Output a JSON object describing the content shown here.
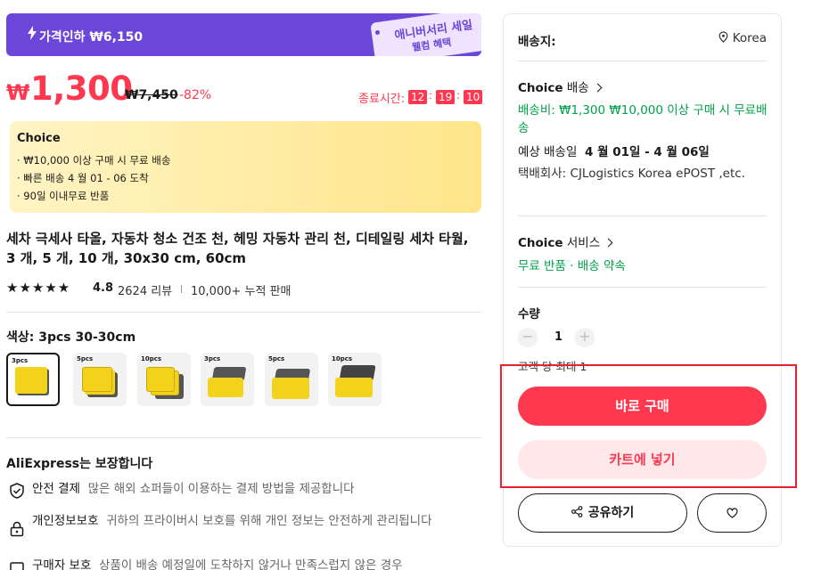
{
  "promo": {
    "text": "가격인하 ₩6,150",
    "tag_line1": "애니버서리 세일",
    "tag_line2": "웰컴 혜택"
  },
  "price": {
    "currency": "₩",
    "current": "1,300",
    "original": "₩7,450",
    "discount": "-82%"
  },
  "timer": {
    "label": "종료시간:",
    "hours": "12",
    "minutes": "19",
    "seconds": "10",
    "sep": ":"
  },
  "choice": {
    "title": "Choice",
    "lines": [
      "· ₩10,000 이상 구매 시 무료 배송",
      "· 빠른 배송 4 월 01 - 06 도착",
      "· 90일 이내무료 반품"
    ]
  },
  "product": {
    "title": "세차 극세사 타올, 자동차 청소 건조 천, 헤밍 자동차 관리 천, 디테일링 세차 타월, 3 개, 5 개, 10 개, 30x30 cm, 60cm",
    "stars": "★★★★★",
    "rating": "4.8",
    "reviews": "2624 리뷰",
    "sold": "10,000+ 누적 판매"
  },
  "color": {
    "label": "색상: 3pcs 30-30cm",
    "swatches": [
      {
        "pcs": "3pcs",
        "selected": true
      },
      {
        "pcs": "5pcs",
        "selected": false
      },
      {
        "pcs": "10pcs",
        "selected": false
      },
      {
        "pcs": "3pcs",
        "selected": false
      },
      {
        "pcs": "5pcs",
        "selected": false
      },
      {
        "pcs": "10pcs",
        "selected": false
      }
    ]
  },
  "guarantee": {
    "title": "AliExpress는 보장합니다",
    "items": [
      {
        "icon": "shield-check-icon",
        "title": "안전 결제",
        "desc": "많은 해외 쇼퍼들이 이용하는 결제 방법을 제공합니다"
      },
      {
        "icon": "lock-icon",
        "title": "개인정보보호",
        "desc": "귀하의 프라이버시 보호를 위해 개인 정보는 안전하게 관리됩니다"
      },
      {
        "icon": "package-icon",
        "title": "구매자 보호",
        "desc": "상품이 배송 예정일에 도착하지 않거나 만족스럽지 않은 경우"
      }
    ]
  },
  "shipping": {
    "label": "배송지:",
    "location": "Korea",
    "choice_delivery": "배송",
    "choice_brand": "Choice",
    "fee": "배송비: ₩1,300  ₩10,000 이상 구매 시 무료배송",
    "estimate_label": "예상 배송일",
    "estimate_dates": "4 월 01일 - 4 월 06일",
    "carrier": "택배회사:  CJLogistics  Korea ePOST ,etc."
  },
  "service": {
    "brand": "Choice",
    "label": "서비스",
    "text": "무료 반품 · 배송 약속"
  },
  "quantity": {
    "label": "수량",
    "value": "1",
    "limit": "고객 당 최대 1"
  },
  "buttons": {
    "buy": "바로 구매",
    "cart": "카트에 넣기",
    "share": "공유하기"
  },
  "colors": {
    "accent": "#fd384f",
    "purple": "#6b46d9",
    "green": "#00a04a",
    "highlight": "#e8212e"
  }
}
